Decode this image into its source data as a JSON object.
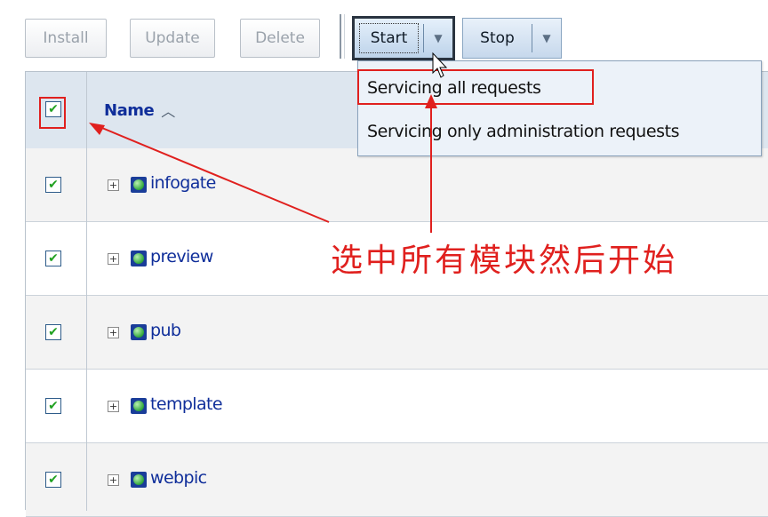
{
  "toolbar": {
    "install_label": "Install",
    "update_label": "Update",
    "delete_label": "Delete",
    "start_label": "Start",
    "stop_label": "Stop"
  },
  "start_menu": {
    "items": [
      {
        "label": "Servicing all requests"
      },
      {
        "label": "Servicing only administration requests"
      }
    ]
  },
  "table": {
    "header": {
      "name_label": "Name",
      "select_all_checked": true
    },
    "rows": [
      {
        "name": "infogate",
        "checked": true
      },
      {
        "name": "preview",
        "checked": true
      },
      {
        "name": "pub",
        "checked": true
      },
      {
        "name": "template",
        "checked": true
      },
      {
        "name": "webpic",
        "checked": true
      }
    ]
  },
  "annotation": {
    "text": "选中所有模块然后开始",
    "color": "#e0201e"
  },
  "colors": {
    "link_blue": "#0f2e9a",
    "header_bg": "#dde6ef",
    "menu_bg": "#ecf2f9",
    "annotation_red": "#e0201e"
  }
}
